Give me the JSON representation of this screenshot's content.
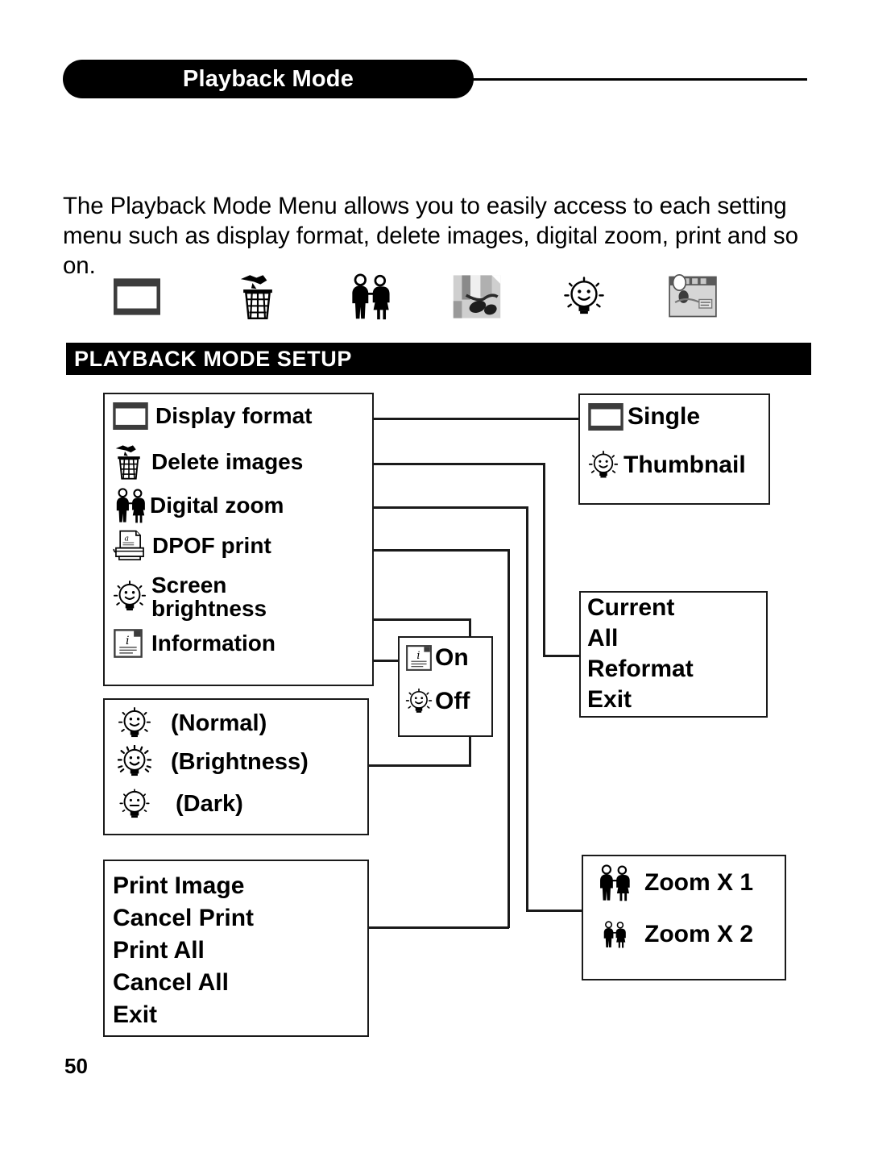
{
  "header": {
    "title": "Playback Mode"
  },
  "intro": {
    "text": "The Playback Mode Menu allows you to easily access to each setting menu such as display format, delete images, digital zoom, print and so on."
  },
  "icon_strip": {
    "icons": [
      {
        "name": "display-format-icon",
        "label": "Display format"
      },
      {
        "name": "delete-images-icon",
        "label": "Delete images"
      },
      {
        "name": "digital-zoom-icon",
        "label": "Digital zoom"
      },
      {
        "name": "dpof-print-icon",
        "label": "DPOF print"
      },
      {
        "name": "screen-brightness-icon",
        "label": "Screen brightness"
      },
      {
        "name": "information-icon",
        "label": "Information"
      }
    ]
  },
  "section": {
    "title": "PLAYBACK MODE SETUP"
  },
  "menu": {
    "items": [
      {
        "icon": "display-format-icon",
        "label": "Display format"
      },
      {
        "icon": "delete-images-icon",
        "label": "Delete images"
      },
      {
        "icon": "digital-zoom-icon",
        "label": "Digital zoom"
      },
      {
        "icon": "dpof-print-icon",
        "label": "DPOF print"
      },
      {
        "icon": "screen-brightness-icon",
        "label": "Screen",
        "label2": "brightness"
      },
      {
        "icon": "information-icon",
        "label": "Information"
      }
    ]
  },
  "display_options": {
    "items": [
      {
        "icon": "display-format-icon",
        "label": "Single"
      },
      {
        "icon": "thumbnail-bulb-icon",
        "label": "Thumbnail"
      }
    ]
  },
  "delete_options": {
    "items": [
      "Current",
      "All",
      "Reformat",
      "Exit"
    ]
  },
  "information_options": {
    "items": [
      {
        "icon": "information-icon",
        "label": "On"
      },
      {
        "icon": "screen-brightness-icon",
        "label": "Off"
      }
    ]
  },
  "brightness_options": {
    "items": [
      {
        "icon": "bulb-normal-icon",
        "label": "(Normal)"
      },
      {
        "icon": "bulb-bright-icon",
        "label": "(Brightness)"
      },
      {
        "icon": "bulb-dark-icon",
        "label": "(Dark)"
      }
    ]
  },
  "print_options": {
    "items": [
      "Print Image",
      "Cancel Print",
      "Print All",
      "Cancel All",
      "Exit"
    ]
  },
  "zoom_options": {
    "items": [
      {
        "icon": "digital-zoom-icon",
        "label": "Zoom X 1"
      },
      {
        "icon": "digital-zoom-small-icon",
        "label": "Zoom X 2"
      }
    ]
  },
  "footer": {
    "page_number": "50"
  },
  "colors": {
    "ink": "#000000",
    "line": "#1a1a1a",
    "paper": "#ffffff",
    "icon_gray": "#4a4a4a"
  }
}
